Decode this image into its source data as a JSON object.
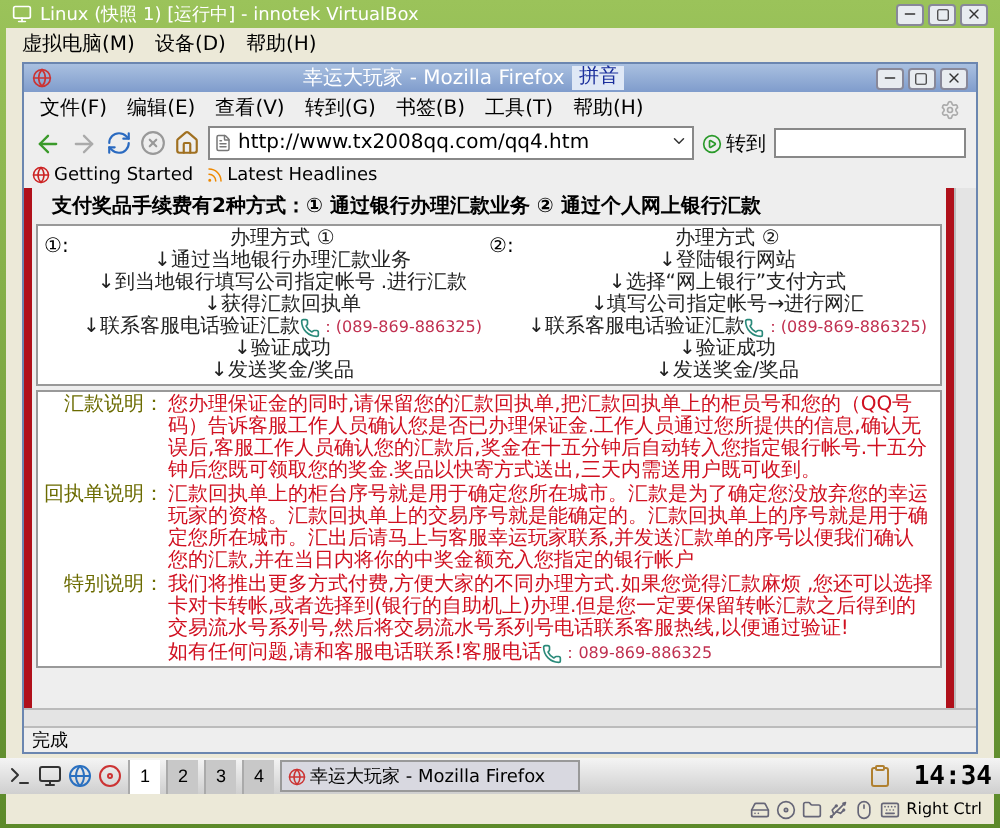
{
  "vbox": {
    "title": "Linux (快照 1) [运行中] - innotek VirtualBox",
    "menu": [
      "虚拟电脑(M)",
      "设备(D)",
      "帮助(H)"
    ],
    "host_key": "Right Ctrl"
  },
  "firefox": {
    "title": "幸运大玩家 - Mozilla Firefox",
    "ime": "拼音",
    "menu": [
      "文件(F)",
      "编辑(E)",
      "查看(V)",
      "转到(G)",
      "书签(B)",
      "工具(T)",
      "帮助(H)"
    ],
    "url": "http://www.tx2008qq.com/qq4.htm",
    "go": "转到",
    "bookmarks": [
      "Getting Started",
      "Latest Headlines"
    ],
    "status": "完成"
  },
  "page": {
    "heading": "支付奖品手续费有2种方式：① 通过银行办理汇款业务 ② 通过个人网上银行汇款",
    "columns": [
      {
        "marker": "①:",
        "title": "办理方式 ①",
        "steps": [
          {
            "text": "↓通过当地银行办理汇款业务"
          },
          {
            "text": "↓到当地银行填写公司指定帐号 .进行汇款"
          },
          {
            "text": "↓获得汇款回执单"
          },
          {
            "text": "↓联系客服电话验证汇款",
            "phone": "：(089-869-886325)"
          },
          {
            "text": "↓验证成功"
          },
          {
            "text": "↓发送奖金/奖品"
          }
        ]
      },
      {
        "marker": "②:",
        "title": "办理方式 ②",
        "steps": [
          {
            "text": "↓登陆银行网站"
          },
          {
            "text": "↓选择“网上银行”支付方式"
          },
          {
            "text": "↓填写公司指定帐号→进行网汇"
          },
          {
            "text": "↓联系客服电话验证汇款",
            "phone": "：(089-869-886325)"
          },
          {
            "text": "↓验证成功"
          },
          {
            "text": "↓发送奖金/奖品"
          }
        ]
      }
    ],
    "notes": [
      {
        "label": "汇款说明：",
        "text": "您办理保证金的同时,请保留您的汇款回执单,把汇款回执单上的柜员号和您的（QQ号码）告诉客服工作人员确认您是否已办理保证金.工作人员通过您所提供的信息,确认无误后,客服工作人员确认您的汇款后,奖金在十五分钟后自动转入您指定银行帐号.十五分钟后您既可领取您的奖金.奖品以快寄方式送出,三天内需送用户既可收到。"
      },
      {
        "label": "回执单说明：",
        "text": "汇款回执单上的柜台序号就是用于确定您所在城市。汇款是为了确定您没放弃您的幸运玩家的资格。汇款回执单上的交易序号就是能确定的。汇款回执单上的序号就是用于确定您所在城市。汇出后请马上与客服幸运玩家联系,并发送汇款单的序号以便我们确认您的汇款,并在当日内将你的中奖金额充入您指定的银行帐户"
      },
      {
        "label": "特别说明：",
        "text": "我们将推出更多方式付费,方便大家的不同办理方式.如果您觉得汇款麻烦 ,您还可以选择卡对卡转帐,或者选择到(银行的自助机上)办理.但是您一定要保留转帐汇款之后得到的交易流水号系列号,然后将交易流水号系列号电话联系客服热线,以便通过验证!"
      }
    ],
    "contact": "如有任何问题,请和客服电话联系!客服电话",
    "contact_phone": "：089-869-886325"
  },
  "taskbar": {
    "desktops": [
      {
        "label": "1",
        "selected": true
      },
      {
        "label": "2",
        "selected": false
      },
      {
        "label": "3",
        "selected": false
      },
      {
        "label": "4",
        "selected": false
      }
    ],
    "task": "幸运大玩家 - Mozilla Firefox",
    "clock": "14:34"
  }
}
